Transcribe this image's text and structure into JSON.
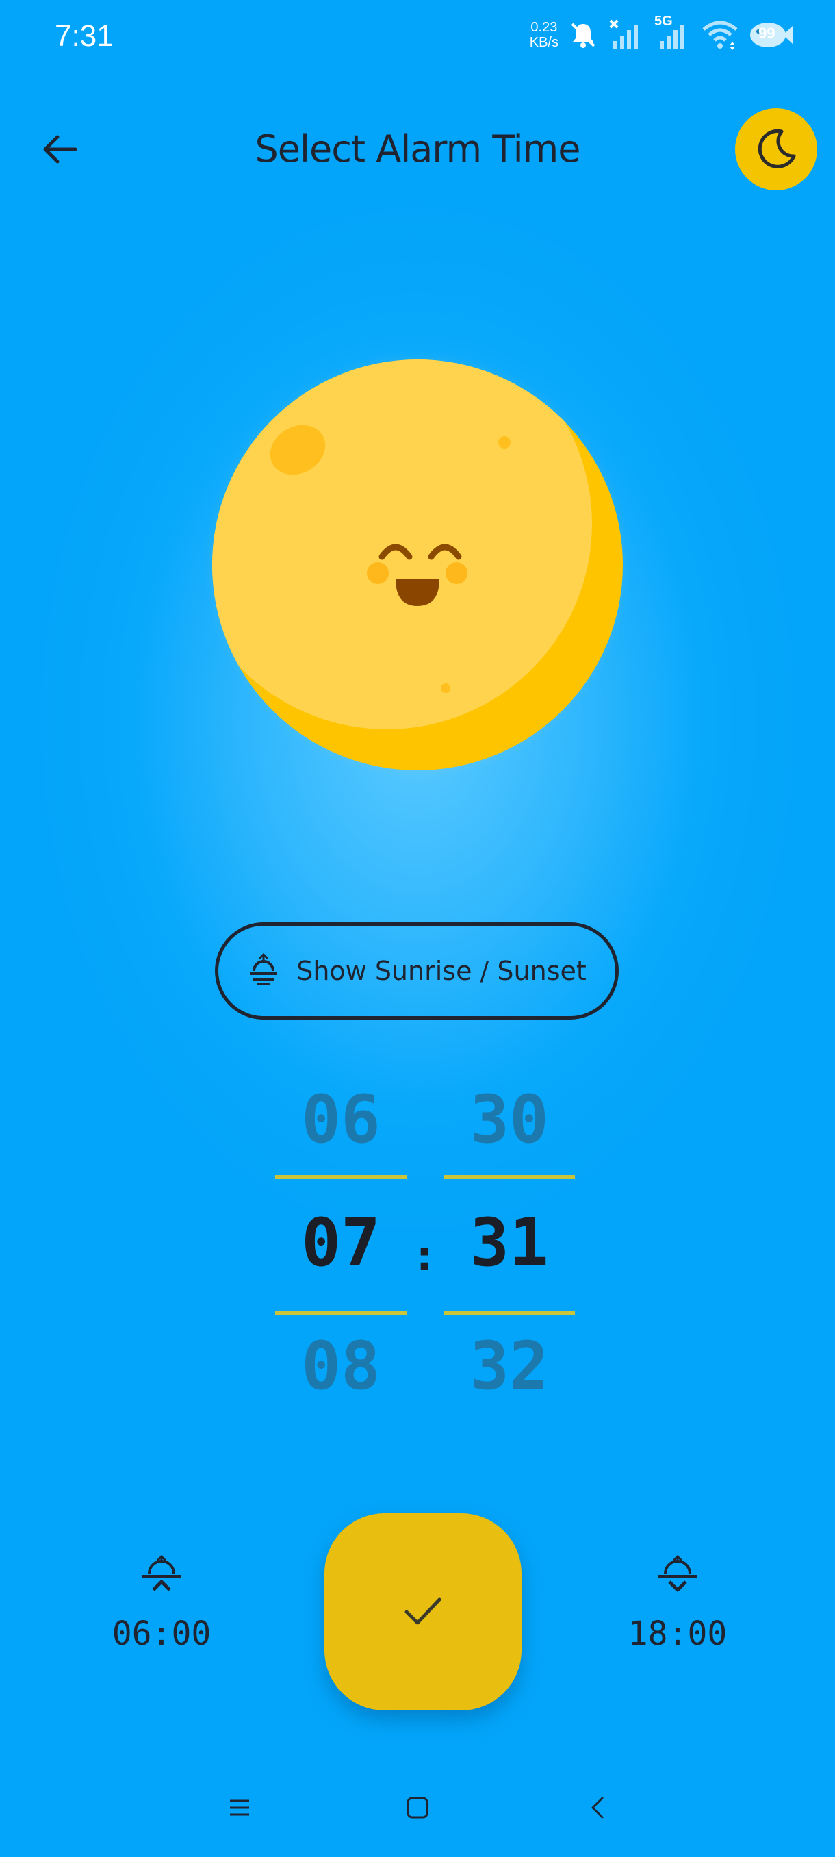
{
  "status_bar": {
    "time": "7:31",
    "net_speed_value": "0.23",
    "net_speed_unit": "KB/s",
    "network_type": "5G",
    "battery_level": "99"
  },
  "header": {
    "title": "Select Alarm Time",
    "back_icon": "arrow-left-icon",
    "theme_icon": "moon-icon"
  },
  "colors": {
    "background": "#03a5fa",
    "accent_yellow": "#f5c400",
    "confirm_button": "#e8bf10",
    "text_dark": "#1f2430",
    "picker_line": "#c9c43a"
  },
  "sunrise_toggle": {
    "label": "Show Sunrise / Sunset",
    "icon": "sunrise-icon"
  },
  "time_picker": {
    "hours": {
      "prev": "06",
      "current": "07",
      "next": "08"
    },
    "separator": ":",
    "minutes": {
      "prev": "30",
      "current": "31",
      "next": "32"
    }
  },
  "sunrise": {
    "time": "06:00",
    "icon": "sunrise-icon"
  },
  "sunset": {
    "time": "18:00",
    "icon": "sunset-icon"
  },
  "confirm": {
    "icon": "check-icon"
  },
  "nav_bar": {
    "menu_icon": "menu-icon",
    "home_icon": "home-icon",
    "back_icon": "back-chevron-icon"
  }
}
